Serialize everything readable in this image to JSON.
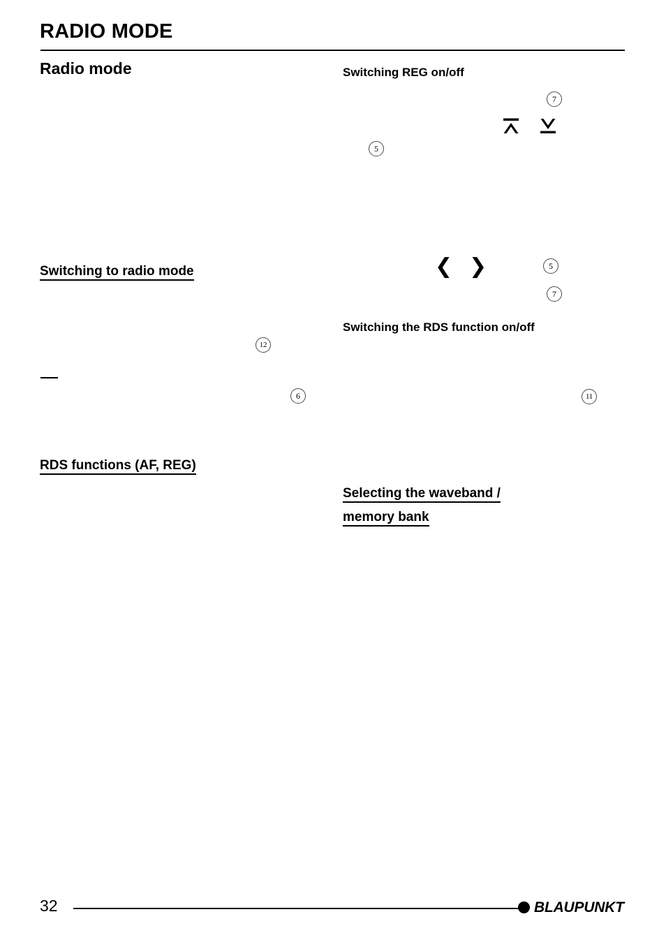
{
  "page": {
    "running_head": "RADIO MODE",
    "number": "32"
  },
  "left_column": {
    "section_title": "Radio mode",
    "headings": [
      {
        "id": "switching-to-radio-mode",
        "text": "Switching to radio mode"
      },
      {
        "id": "rds-functions",
        "text": "RDS functions (AF, REG)"
      }
    ],
    "refs": [
      {
        "value": "12"
      },
      {
        "value": "6"
      }
    ]
  },
  "right_column": {
    "headings": [
      {
        "id": "switching-reg",
        "text": "Switching REG on/off"
      },
      {
        "id": "switching-rds-function",
        "text": "Switching the RDS function on/off"
      }
    ],
    "underlined_heading": {
      "id": "selecting-waveband",
      "line1": "Selecting the waveband /",
      "line2": "memory bank"
    },
    "refs": [
      {
        "value": "7"
      },
      {
        "value": "5"
      },
      {
        "value": "5"
      },
      {
        "value": "7"
      },
      {
        "value": "11"
      }
    ],
    "keys": {
      "up_arrow": "up-arrow-bar-key",
      "down_arrow": "down-arrow-bar-key",
      "left_chevron": "❮",
      "right_chevron": "❯"
    }
  },
  "footer": {
    "page_number": "32",
    "brand": "BLAUPUNKT"
  },
  "colors": {
    "text": "#000000",
    "background": "#ffffff",
    "ref_circle_border": "#4a4a4a"
  }
}
